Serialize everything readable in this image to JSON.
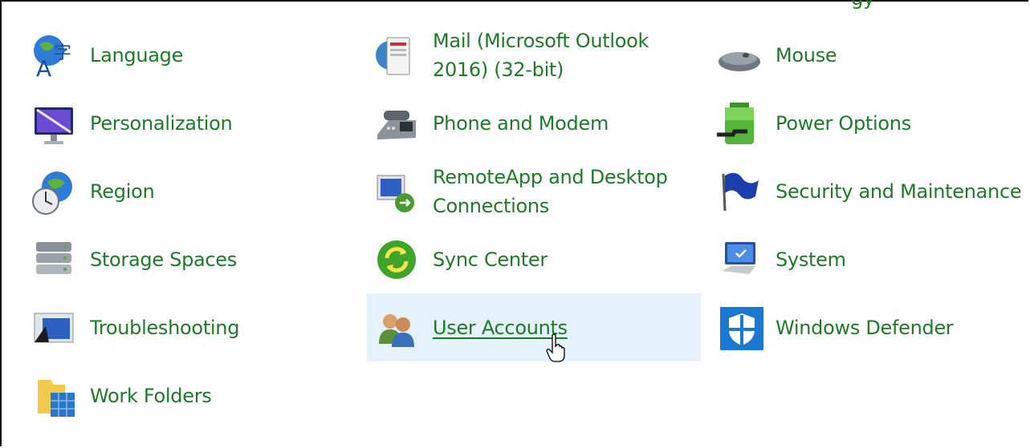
{
  "clipped_label": "gy",
  "items": [
    {
      "label": "Language",
      "icon": "language-icon"
    },
    {
      "label": "Mail (Microsoft Outlook 2016) (32-bit)",
      "icon": "mail-icon"
    },
    {
      "label": "Mouse",
      "icon": "mouse-icon"
    },
    {
      "label": "Personalization",
      "icon": "personalization-icon"
    },
    {
      "label": "Phone and Modem",
      "icon": "phone-modem-icon"
    },
    {
      "label": "Power Options",
      "icon": "power-options-icon"
    },
    {
      "label": "Region",
      "icon": "region-icon"
    },
    {
      "label": "RemoteApp and Desktop Connections",
      "icon": "remoteapp-icon"
    },
    {
      "label": "Security and Maintenance",
      "icon": "security-flag-icon"
    },
    {
      "label": "Storage Spaces",
      "icon": "storage-spaces-icon"
    },
    {
      "label": "Sync Center",
      "icon": "sync-center-icon"
    },
    {
      "label": "System",
      "icon": "system-icon"
    },
    {
      "label": "Troubleshooting",
      "icon": "troubleshooting-icon"
    },
    {
      "label": "User Accounts",
      "icon": "user-accounts-icon",
      "hovered": true
    },
    {
      "label": "Windows Defender",
      "icon": "windows-defender-icon"
    },
    {
      "label": "Work Folders",
      "icon": "work-folders-icon"
    }
  ],
  "colors": {
    "link": "#1e7a28",
    "hover_bg": "#e5f1fb"
  }
}
